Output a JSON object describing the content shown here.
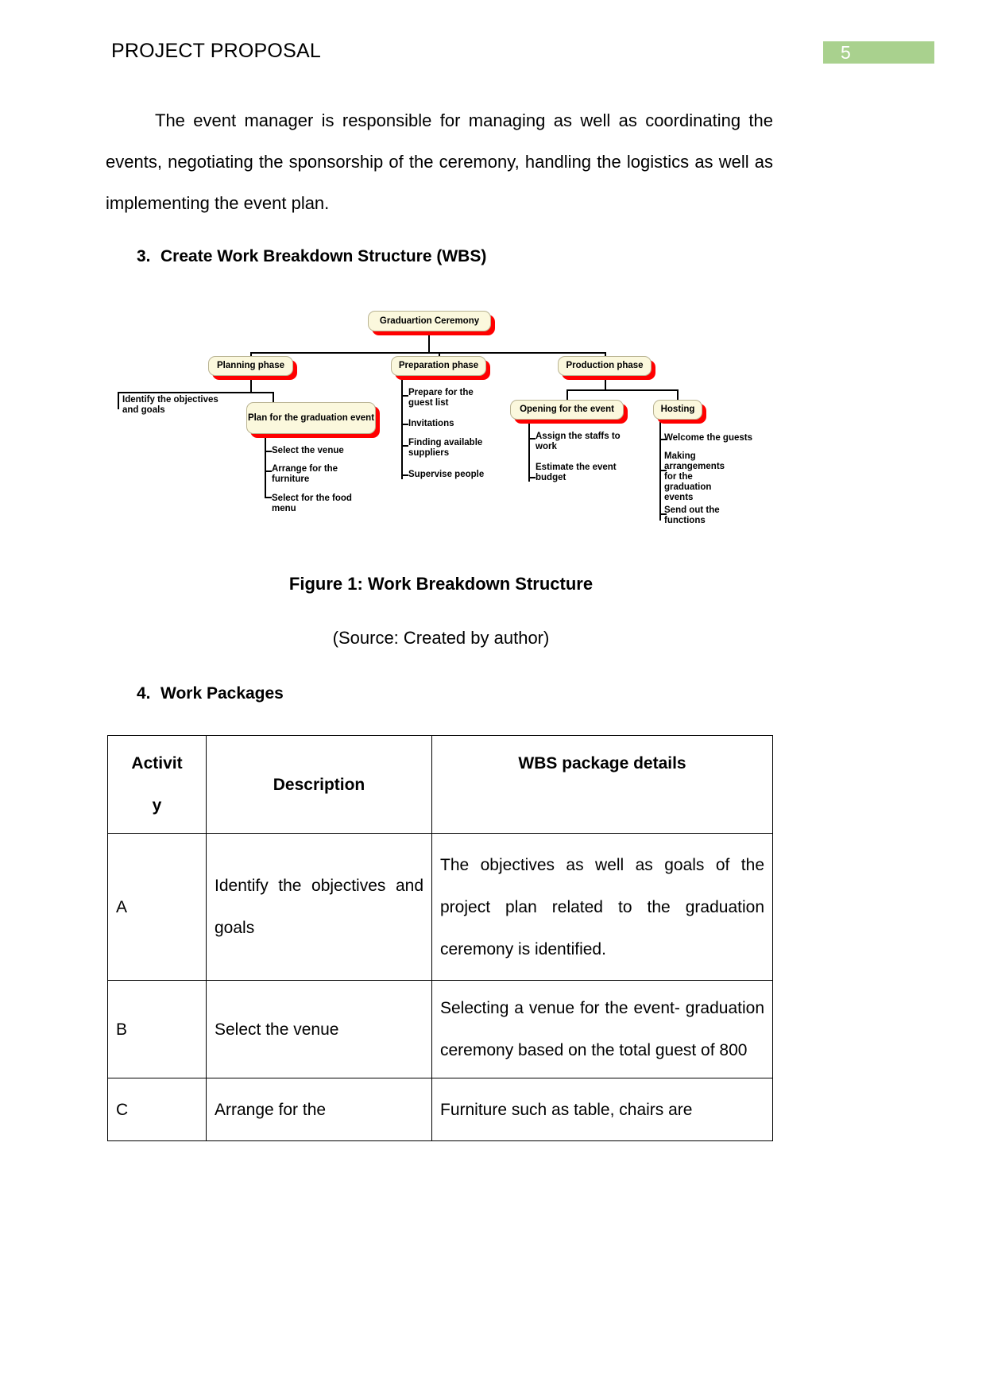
{
  "header": {
    "title": "PROJECT PROPOSAL",
    "page_number": "5",
    "badge_color": "#a9d18e"
  },
  "paragraphs": {
    "intro": "The event manager is responsible for managing as well as coordinating the events, negotiating the sponsorship of the ceremony, handling the logistics as well as implementing the event plan."
  },
  "headings": {
    "wbs": {
      "number": "3.",
      "text": "Create Work Breakdown Structure (WBS)"
    },
    "work_packages": {
      "number": "4.",
      "text": "Work Packages"
    }
  },
  "figure": {
    "caption": "Figure 1: Work Breakdown Structure",
    "source": "(Source: Created by author)"
  },
  "wbs_diagram": {
    "node_fill": "#fbf8dd",
    "node_shadow": "#ff0000",
    "root": "Graduartion Ceremony",
    "phases": {
      "planning": "Planning phase",
      "preparation": "Preparation phase",
      "production": "Production phase"
    },
    "planning_children": {
      "objectives_leaf": "Identify the objectives and goals",
      "plan_box": "Plan for the graduation event",
      "plan_leaves": [
        "Select the venue",
        "Arrange for the furniture",
        "Select for the food menu"
      ]
    },
    "preparation_leaves": [
      "Prepare for the guest list",
      "Invitations",
      "Finding available suppliers",
      "Supervise people"
    ],
    "production_children": {
      "opening_box": "Opening for the event",
      "opening_leaves": [
        "Assign the staffs to work",
        "Estimate the event budget"
      ],
      "hosting_box": "Hosting",
      "hosting_leaves": [
        "Welcome the guests",
        "Making arrangements for the graduation events",
        "Send out the functions"
      ]
    }
  },
  "work_packages_table": {
    "headers": {
      "activity_line1": "Activit",
      "activity_line2": "y",
      "description": "Description",
      "wbs_details": "WBS package details"
    },
    "rows": [
      {
        "activity": "A",
        "description": "Identify the objectives and goals",
        "details": "The objectives as well as goals of the project plan related to the graduation ceremony is identified."
      },
      {
        "activity": "B",
        "description": "Select the venue",
        "details": "Selecting a venue for the event- graduation ceremony based on the total guest of 800"
      },
      {
        "activity": "C",
        "description": "Arrange for the",
        "details": "Furniture such as table, chairs are"
      }
    ]
  }
}
